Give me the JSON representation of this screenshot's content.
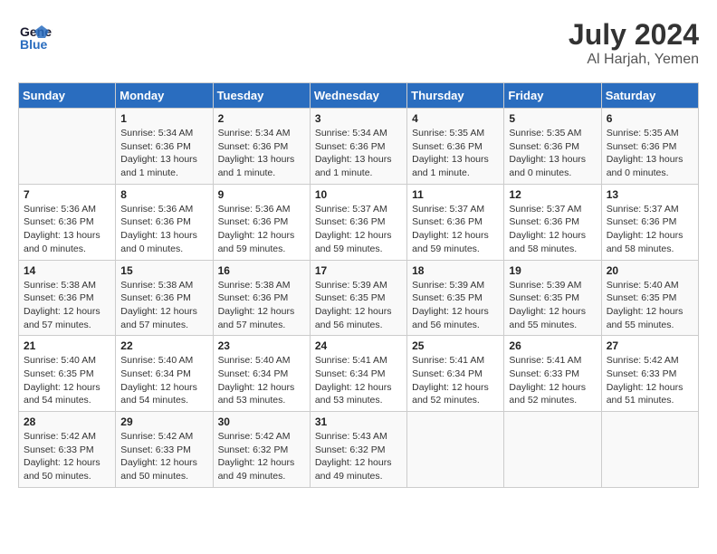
{
  "logo": {
    "line1": "General",
    "line2": "Blue"
  },
  "title": "July 2024",
  "location": "Al Harjah, Yemen",
  "days_of_week": [
    "Sunday",
    "Monday",
    "Tuesday",
    "Wednesday",
    "Thursday",
    "Friday",
    "Saturday"
  ],
  "weeks": [
    [
      {
        "day": "",
        "sunrise": "",
        "sunset": "",
        "daylight": ""
      },
      {
        "day": "1",
        "sunrise": "Sunrise: 5:34 AM",
        "sunset": "Sunset: 6:36 PM",
        "daylight": "Daylight: 13 hours and 1 minute."
      },
      {
        "day": "2",
        "sunrise": "Sunrise: 5:34 AM",
        "sunset": "Sunset: 6:36 PM",
        "daylight": "Daylight: 13 hours and 1 minute."
      },
      {
        "day": "3",
        "sunrise": "Sunrise: 5:34 AM",
        "sunset": "Sunset: 6:36 PM",
        "daylight": "Daylight: 13 hours and 1 minute."
      },
      {
        "day": "4",
        "sunrise": "Sunrise: 5:35 AM",
        "sunset": "Sunset: 6:36 PM",
        "daylight": "Daylight: 13 hours and 1 minute."
      },
      {
        "day": "5",
        "sunrise": "Sunrise: 5:35 AM",
        "sunset": "Sunset: 6:36 PM",
        "daylight": "Daylight: 13 hours and 0 minutes."
      },
      {
        "day": "6",
        "sunrise": "Sunrise: 5:35 AM",
        "sunset": "Sunset: 6:36 PM",
        "daylight": "Daylight: 13 hours and 0 minutes."
      }
    ],
    [
      {
        "day": "7",
        "sunrise": "Sunrise: 5:36 AM",
        "sunset": "Sunset: 6:36 PM",
        "daylight": "Daylight: 13 hours and 0 minutes."
      },
      {
        "day": "8",
        "sunrise": "Sunrise: 5:36 AM",
        "sunset": "Sunset: 6:36 PM",
        "daylight": "Daylight: 13 hours and 0 minutes."
      },
      {
        "day": "9",
        "sunrise": "Sunrise: 5:36 AM",
        "sunset": "Sunset: 6:36 PM",
        "daylight": "Daylight: 12 hours and 59 minutes."
      },
      {
        "day": "10",
        "sunrise": "Sunrise: 5:37 AM",
        "sunset": "Sunset: 6:36 PM",
        "daylight": "Daylight: 12 hours and 59 minutes."
      },
      {
        "day": "11",
        "sunrise": "Sunrise: 5:37 AM",
        "sunset": "Sunset: 6:36 PM",
        "daylight": "Daylight: 12 hours and 59 minutes."
      },
      {
        "day": "12",
        "sunrise": "Sunrise: 5:37 AM",
        "sunset": "Sunset: 6:36 PM",
        "daylight": "Daylight: 12 hours and 58 minutes."
      },
      {
        "day": "13",
        "sunrise": "Sunrise: 5:37 AM",
        "sunset": "Sunset: 6:36 PM",
        "daylight": "Daylight: 12 hours and 58 minutes."
      }
    ],
    [
      {
        "day": "14",
        "sunrise": "Sunrise: 5:38 AM",
        "sunset": "Sunset: 6:36 PM",
        "daylight": "Daylight: 12 hours and 57 minutes."
      },
      {
        "day": "15",
        "sunrise": "Sunrise: 5:38 AM",
        "sunset": "Sunset: 6:36 PM",
        "daylight": "Daylight: 12 hours and 57 minutes."
      },
      {
        "day": "16",
        "sunrise": "Sunrise: 5:38 AM",
        "sunset": "Sunset: 6:36 PM",
        "daylight": "Daylight: 12 hours and 57 minutes."
      },
      {
        "day": "17",
        "sunrise": "Sunrise: 5:39 AM",
        "sunset": "Sunset: 6:35 PM",
        "daylight": "Daylight: 12 hours and 56 minutes."
      },
      {
        "day": "18",
        "sunrise": "Sunrise: 5:39 AM",
        "sunset": "Sunset: 6:35 PM",
        "daylight": "Daylight: 12 hours and 56 minutes."
      },
      {
        "day": "19",
        "sunrise": "Sunrise: 5:39 AM",
        "sunset": "Sunset: 6:35 PM",
        "daylight": "Daylight: 12 hours and 55 minutes."
      },
      {
        "day": "20",
        "sunrise": "Sunrise: 5:40 AM",
        "sunset": "Sunset: 6:35 PM",
        "daylight": "Daylight: 12 hours and 55 minutes."
      }
    ],
    [
      {
        "day": "21",
        "sunrise": "Sunrise: 5:40 AM",
        "sunset": "Sunset: 6:35 PM",
        "daylight": "Daylight: 12 hours and 54 minutes."
      },
      {
        "day": "22",
        "sunrise": "Sunrise: 5:40 AM",
        "sunset": "Sunset: 6:34 PM",
        "daylight": "Daylight: 12 hours and 54 minutes."
      },
      {
        "day": "23",
        "sunrise": "Sunrise: 5:40 AM",
        "sunset": "Sunset: 6:34 PM",
        "daylight": "Daylight: 12 hours and 53 minutes."
      },
      {
        "day": "24",
        "sunrise": "Sunrise: 5:41 AM",
        "sunset": "Sunset: 6:34 PM",
        "daylight": "Daylight: 12 hours and 53 minutes."
      },
      {
        "day": "25",
        "sunrise": "Sunrise: 5:41 AM",
        "sunset": "Sunset: 6:34 PM",
        "daylight": "Daylight: 12 hours and 52 minutes."
      },
      {
        "day": "26",
        "sunrise": "Sunrise: 5:41 AM",
        "sunset": "Sunset: 6:33 PM",
        "daylight": "Daylight: 12 hours and 52 minutes."
      },
      {
        "day": "27",
        "sunrise": "Sunrise: 5:42 AM",
        "sunset": "Sunset: 6:33 PM",
        "daylight": "Daylight: 12 hours and 51 minutes."
      }
    ],
    [
      {
        "day": "28",
        "sunrise": "Sunrise: 5:42 AM",
        "sunset": "Sunset: 6:33 PM",
        "daylight": "Daylight: 12 hours and 50 minutes."
      },
      {
        "day": "29",
        "sunrise": "Sunrise: 5:42 AM",
        "sunset": "Sunset: 6:33 PM",
        "daylight": "Daylight: 12 hours and 50 minutes."
      },
      {
        "day": "30",
        "sunrise": "Sunrise: 5:42 AM",
        "sunset": "Sunset: 6:32 PM",
        "daylight": "Daylight: 12 hours and 49 minutes."
      },
      {
        "day": "31",
        "sunrise": "Sunrise: 5:43 AM",
        "sunset": "Sunset: 6:32 PM",
        "daylight": "Daylight: 12 hours and 49 minutes."
      },
      {
        "day": "",
        "sunrise": "",
        "sunset": "",
        "daylight": ""
      },
      {
        "day": "",
        "sunrise": "",
        "sunset": "",
        "daylight": ""
      },
      {
        "day": "",
        "sunrise": "",
        "sunset": "",
        "daylight": ""
      }
    ]
  ]
}
